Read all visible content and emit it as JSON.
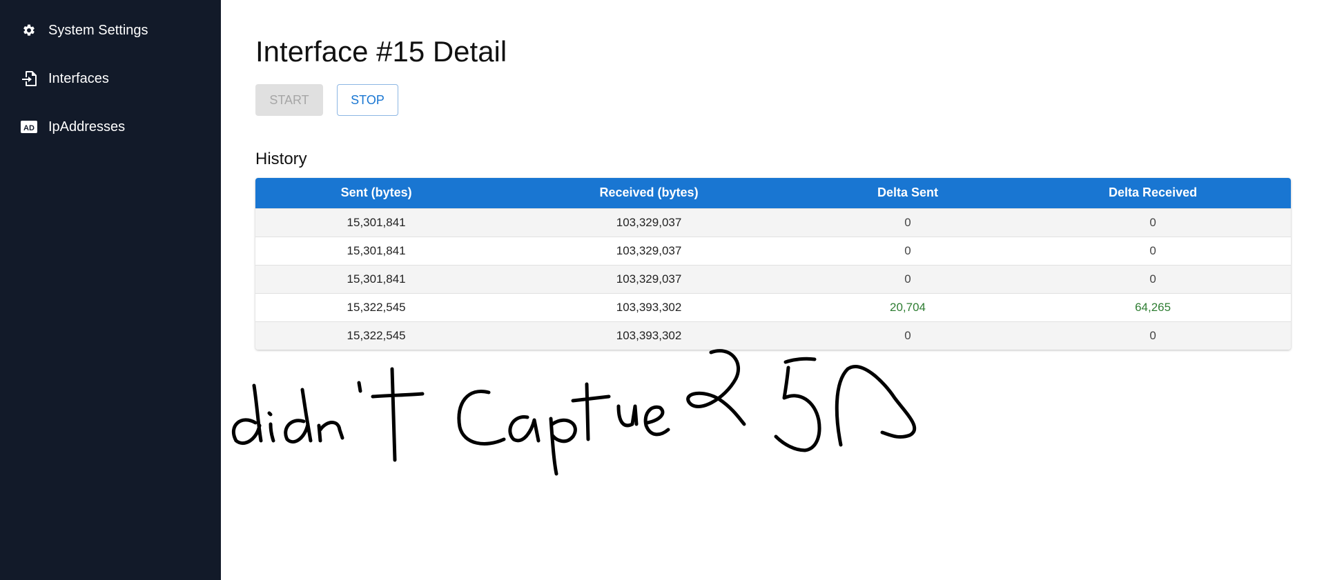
{
  "sidebar": {
    "items": [
      {
        "label": "System Settings",
        "icon": "gear-icon"
      },
      {
        "label": "Interfaces",
        "icon": "file-import-icon"
      },
      {
        "label": "IpAddresses",
        "icon": "ad-icon"
      }
    ]
  },
  "page": {
    "title": "Interface #15 Detail"
  },
  "actions": {
    "start_label": "START",
    "stop_label": "STOP"
  },
  "history": {
    "title": "History",
    "columns": [
      "Sent (bytes)",
      "Received (bytes)",
      "Delta Sent",
      "Delta Received"
    ],
    "rows": [
      {
        "sent": "15,301,841",
        "received": "103,329,037",
        "delta_sent": "0",
        "delta_received": "0"
      },
      {
        "sent": "15,301,841",
        "received": "103,329,037",
        "delta_sent": "0",
        "delta_received": "0"
      },
      {
        "sent": "15,301,841",
        "received": "103,329,037",
        "delta_sent": "0",
        "delta_received": "0"
      },
      {
        "sent": "15,322,545",
        "received": "103,393,302",
        "delta_sent": "20,704",
        "delta_received": "64,265"
      },
      {
        "sent": "15,322,545",
        "received": "103,393,302",
        "delta_sent": "0",
        "delta_received": "0"
      }
    ]
  },
  "annotation": {
    "text": "didn't capture 25s"
  },
  "colors": {
    "sidebar_bg": "#121a29",
    "accent": "#1976d2",
    "positive": "#2e7d32"
  }
}
